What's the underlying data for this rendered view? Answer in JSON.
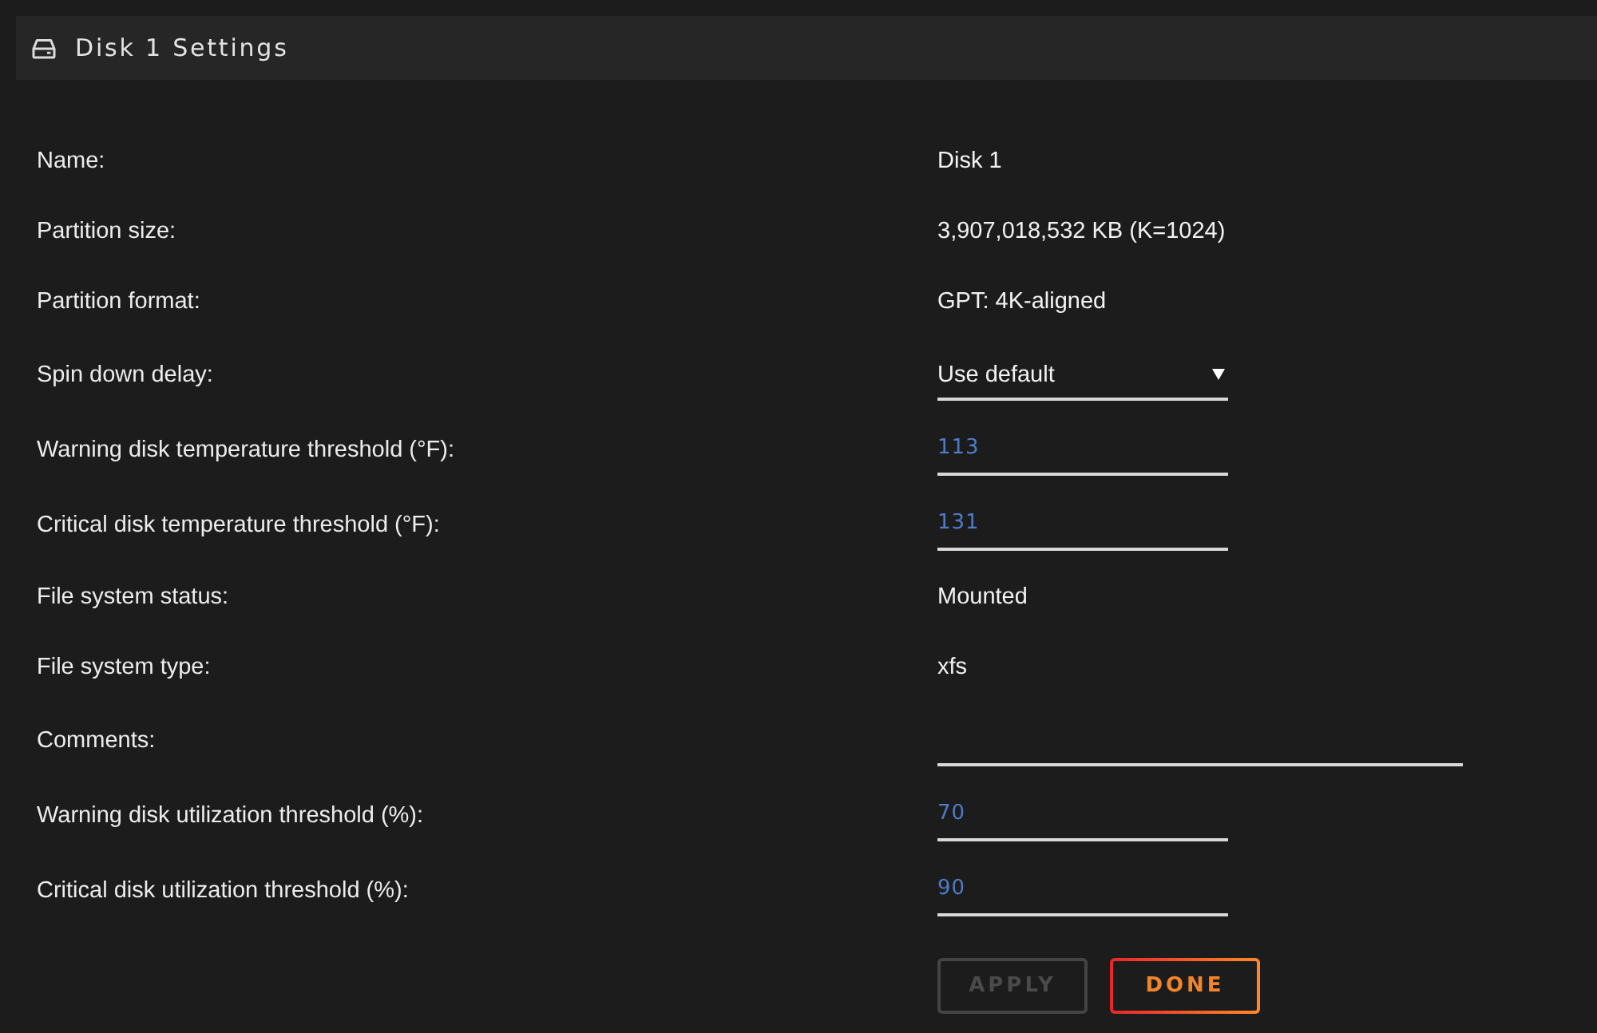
{
  "header": {
    "title": "Disk 1 Settings"
  },
  "fields": [
    {
      "kind": "text",
      "label": "Name:",
      "value": "Disk 1"
    },
    {
      "kind": "text",
      "label": "Partition size:",
      "value": "3,907,018,532 KB (K=1024)"
    },
    {
      "kind": "text",
      "label": "Partition format:",
      "value": "GPT: 4K-aligned"
    },
    {
      "kind": "select",
      "label": "Spin down delay:",
      "value": "Use default"
    },
    {
      "kind": "number",
      "label": "Warning disk temperature threshold (°F):",
      "value": "113"
    },
    {
      "kind": "number",
      "label": "Critical disk temperature threshold (°F):",
      "value": "131"
    },
    {
      "kind": "text",
      "label": "File system status:",
      "value": "Mounted"
    },
    {
      "kind": "text",
      "label": "File system type:",
      "value": "xfs"
    },
    {
      "kind": "comment",
      "label": "Comments:"
    },
    {
      "kind": "number",
      "label": "Warning disk utilization threshold (%):",
      "value": "70"
    },
    {
      "kind": "number",
      "label": "Critical disk utilization threshold (%):",
      "value": "90"
    }
  ],
  "buttons": [
    {
      "label": "APPLY",
      "disabled": true
    },
    {
      "label": "DONE",
      "disabled": false
    }
  ]
}
